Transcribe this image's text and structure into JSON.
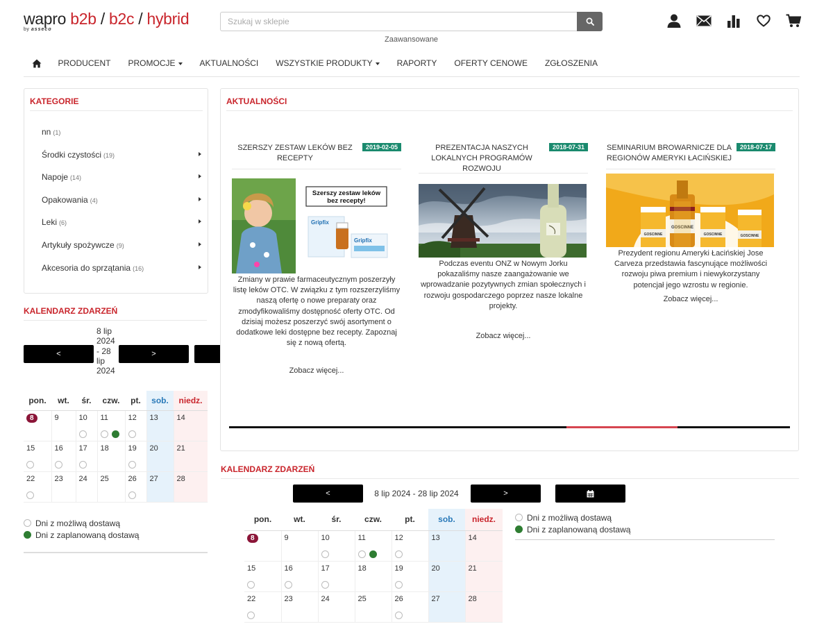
{
  "header": {
    "logo_wapro": "wapro",
    "logo_b2b": "b2b",
    "logo_sep": "/",
    "logo_b2c": "b2c",
    "logo_hybrid": "hybrid",
    "logo_by": "by",
    "logo_asseco": "asseco",
    "search_placeholder": "Szukaj w sklepie",
    "advanced": "Zaawansowane",
    "icons": [
      "user-icon",
      "mail-icon",
      "chart-icon",
      "heart-icon",
      "cart-icon"
    ]
  },
  "nav": {
    "items": [
      {
        "label": "PRODUCENT",
        "dropdown": false
      },
      {
        "label": "PROMOCJE",
        "dropdown": true
      },
      {
        "label": "AKTUALNOŚCI",
        "dropdown": false
      },
      {
        "label": "WSZYSTKIE PRODUKTY",
        "dropdown": true
      },
      {
        "label": "RAPORTY",
        "dropdown": false
      },
      {
        "label": "OFERTY CENOWE",
        "dropdown": false
      },
      {
        "label": "ZGŁOSZENIA",
        "dropdown": false
      }
    ]
  },
  "categories": {
    "title": "KATEGORIE",
    "items": [
      {
        "name": "nn",
        "count": "(1)",
        "arrow": false
      },
      {
        "name": "Środki czystości",
        "count": "(19)",
        "arrow": true
      },
      {
        "name": "Napoje",
        "count": "(14)",
        "arrow": true
      },
      {
        "name": "Opakowania",
        "count": "(4)",
        "arrow": true
      },
      {
        "name": "Leki",
        "count": "(6)",
        "arrow": true
      },
      {
        "name": "Artykuły spożywcze",
        "count": "(9)",
        "arrow": true
      },
      {
        "name": "Akcesoria do sprzątania",
        "count": "(16)",
        "arrow": true
      }
    ]
  },
  "news": {
    "title": "AKTUALNOŚCI",
    "items": [
      {
        "title": "SZERSZY ZESTAW LEKÓW BEZ RECEPTY",
        "date": "2019-02-05",
        "image_caption_line1": "Szerszy zestaw leków",
        "image_caption_line2": "bez recepty!",
        "image_brand": "Gripfix",
        "text": "Zmiany w prawie farmaceutycznym poszerzyły listę leków OTC. W związku z tym rozszerzyliśmy naszą ofertę o nowe preparaty oraz zmodyfikowaliśmy dostępność oferty OTC. Od dzisiaj możesz poszerzyć swój asortyment o dodatkowe leki dostępne bez recepty. Zapoznaj się z nową ofertą.",
        "more": "Zobacz więcej..."
      },
      {
        "title": "PREZENTACJA NASZYCH LOKALNYCH PROGRAMÓW ROZWOJU",
        "date": "2018-07-31",
        "text": "Podczas eventu ONZ w Nowym Jorku pokazaliśmy nasze zaangażowanie we wprowadzanie pozytywnych zmian społecznych i rozwoju gospodarczego poprzez nasze lokalne projekty.",
        "more": "Zobacz więcej..."
      },
      {
        "title": "SEMINARIUM BROWARNICZE DLA REGIONÓW AMERYKI ŁACIŃSKIEJ",
        "date": "2018-07-17",
        "image_label": "GOSCINNE",
        "text": "Prezydent regionu Ameryki Łacińskiej Jose Carveza przedstawia fascynujące możliwości rozwoju piwa premium i niewykorzystany potencjał jego wzrostu w regionie.",
        "more": "Zobacz więcej..."
      }
    ],
    "slider_position": 0.625
  },
  "calendar": {
    "title": "KALENDARZ ZDARZEŃ",
    "prev": "<",
    "next": ">",
    "range": "8 lip 2024 - 28 lip 2024",
    "range_lines": [
      "8 lip",
      "2024",
      "- 28",
      "lip",
      "2024"
    ],
    "days": [
      "pon.",
      "wt.",
      "śr.",
      "czw.",
      "pt.",
      "sob.",
      "niedz."
    ],
    "weeks": [
      [
        {
          "d": "8",
          "today": true,
          "dots": []
        },
        {
          "d": "9",
          "dots": []
        },
        {
          "d": "10",
          "dots": [
            "possible"
          ]
        },
        {
          "d": "11",
          "dots": [
            "possible",
            "planned"
          ]
        },
        {
          "d": "12",
          "dots": [
            "possible"
          ]
        },
        {
          "d": "13",
          "dots": []
        },
        {
          "d": "14",
          "dots": []
        }
      ],
      [
        {
          "d": "15",
          "dots": [
            "possible"
          ]
        },
        {
          "d": "16",
          "dots": [
            "possible"
          ]
        },
        {
          "d": "17",
          "dots": [
            "possible"
          ]
        },
        {
          "d": "18",
          "dots": []
        },
        {
          "d": "19",
          "dots": [
            "possible"
          ]
        },
        {
          "d": "20",
          "dots": []
        },
        {
          "d": "21",
          "dots": []
        }
      ],
      [
        {
          "d": "22",
          "dots": [
            "possible"
          ]
        },
        {
          "d": "23",
          "dots": []
        },
        {
          "d": "24",
          "dots": []
        },
        {
          "d": "25",
          "dots": []
        },
        {
          "d": "26",
          "dots": [
            "possible"
          ]
        },
        {
          "d": "27",
          "dots": []
        },
        {
          "d": "28",
          "dots": []
        }
      ]
    ],
    "legend_possible": "Dni z możliwą dostawą",
    "legend_planned": "Dni z zaplanowaną dostawą"
  },
  "colors": {
    "brand_red": "#c9252c",
    "date_badge": "#1a8a6e",
    "today_badge": "#8b1538",
    "planned_dot": "#2e7d32",
    "saturday_bg": "#e6f2fb",
    "sunday_bg": "#fdf0f0"
  }
}
